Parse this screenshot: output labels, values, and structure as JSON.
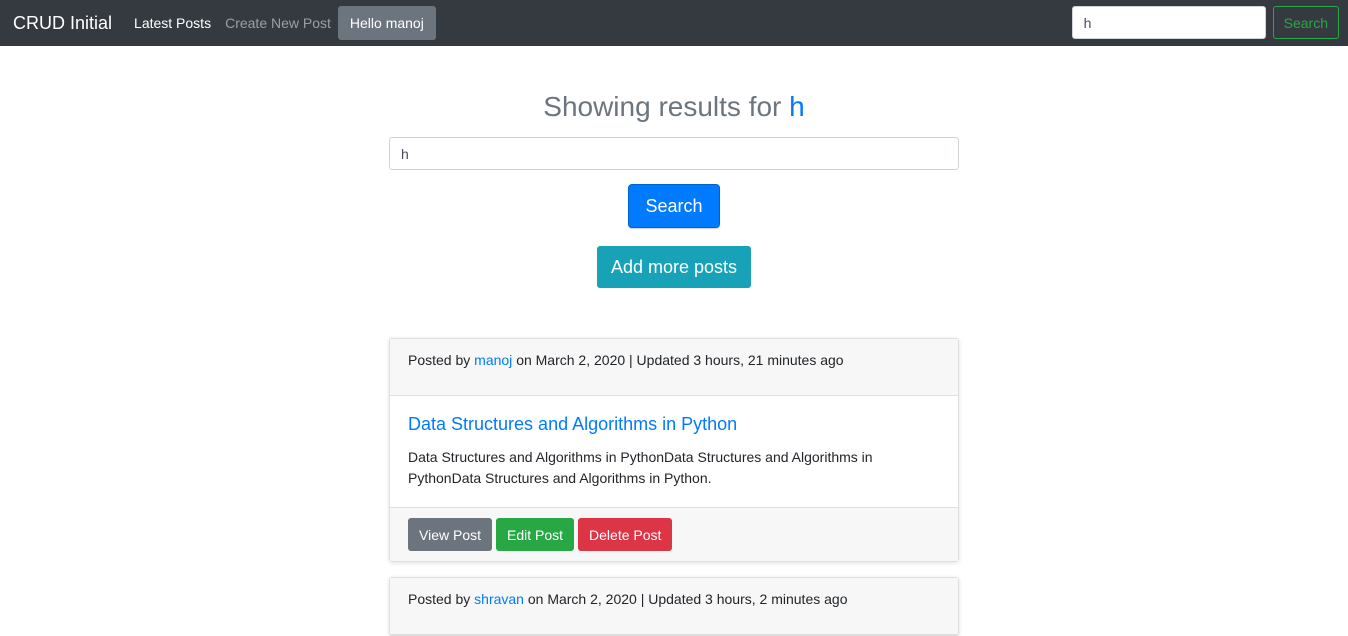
{
  "navbar": {
    "brand": "CRUD Initial",
    "latest_posts": "Latest Posts",
    "create_new_post": "Create New Post",
    "hello_user": "Hello manoj",
    "search_value": "h",
    "search_button": "Search"
  },
  "main": {
    "heading_prefix": "Showing results for",
    "query": "h",
    "search_value": "h",
    "search_button": "Search",
    "add_button": "Add more posts"
  },
  "posts": [
    {
      "posted_by_label": "Posted by",
      "author": "manoj",
      "meta": "on March 2, 2020 | Updated 3 hours, 21 minutes ago",
      "title": "Data Structures and Algorithms in Python",
      "body": "Data Structures and Algorithms in PythonData Structures and Algorithms in PythonData Structures and Algorithms in Python.",
      "view_label": "View Post",
      "edit_label": "Edit Post",
      "delete_label": "Delete Post"
    },
    {
      "posted_by_label": "Posted by",
      "author": "shravan",
      "meta": "on March 2, 2020 | Updated 3 hours, 2 minutes ago"
    }
  ],
  "colors": {
    "navbar": "#343a40",
    "primary": "#007bff",
    "info": "#17a2b8",
    "success": "#28a745",
    "danger": "#dc3545",
    "secondary": "#6c757d"
  }
}
